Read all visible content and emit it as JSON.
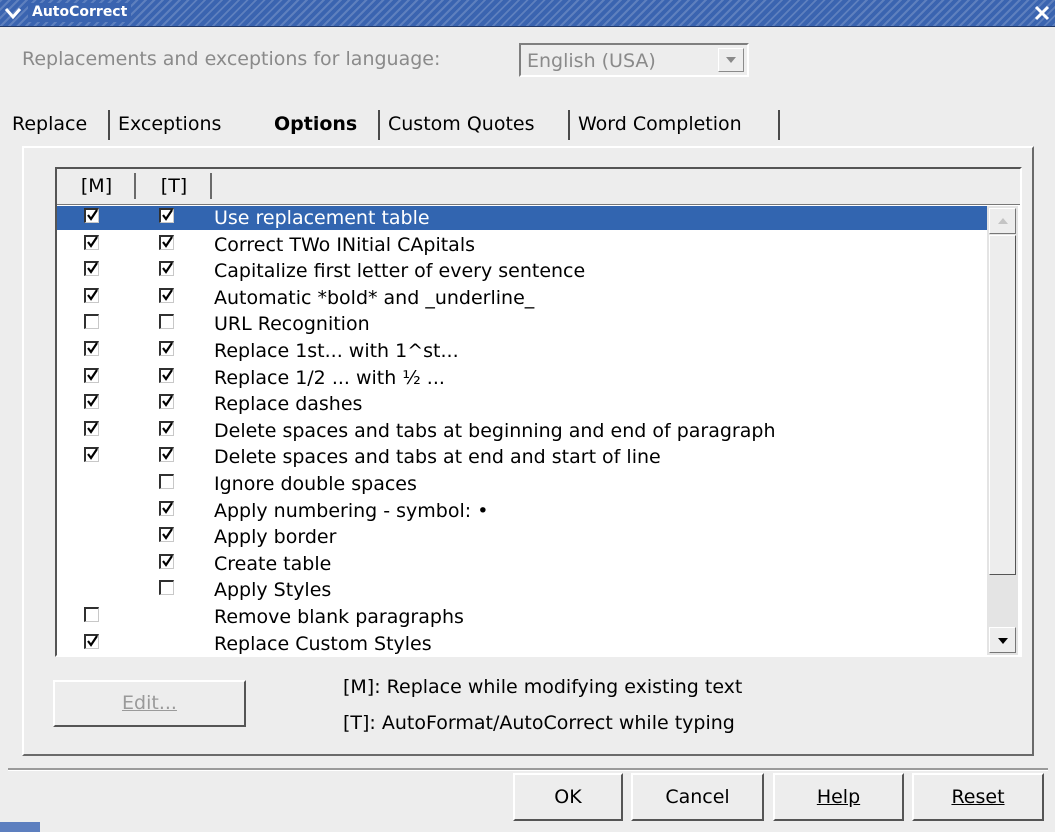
{
  "window": {
    "title": "AutoCorrect"
  },
  "language": {
    "label": "Replacements and exceptions for language:",
    "value": "English (USA)"
  },
  "tabs": [
    {
      "label": "Replace",
      "active": false
    },
    {
      "label": "Exceptions",
      "active": false
    },
    {
      "label": "Options",
      "active": true
    },
    {
      "label": "Custom Quotes",
      "active": false
    },
    {
      "label": "Word Completion",
      "active": false
    }
  ],
  "options": {
    "columns": [
      "[M]",
      "[T]"
    ],
    "rows": [
      {
        "label": "Use replacement table",
        "m": true,
        "t": true,
        "selected": true
      },
      {
        "label": "Correct TWo INitial CApitals",
        "m": true,
        "t": true
      },
      {
        "label": "Capitalize first letter of every sentence",
        "m": true,
        "t": true
      },
      {
        "label": "Automatic *bold* and _underline_",
        "m": true,
        "t": true
      },
      {
        "label": "URL Recognition",
        "m": false,
        "t": false
      },
      {
        "label": "Replace 1st... with 1^st...",
        "m": true,
        "t": true
      },
      {
        "label": "Replace 1/2 ... with ½ ...",
        "m": true,
        "t": true
      },
      {
        "label": "Replace dashes",
        "m": true,
        "t": true
      },
      {
        "label": "Delete spaces and tabs at beginning and end of paragraph",
        "m": true,
        "t": true
      },
      {
        "label": "Delete spaces and tabs at end and start of line",
        "m": true,
        "t": true
      },
      {
        "label": "Ignore double spaces",
        "m": null,
        "t": false
      },
      {
        "label": "Apply numbering - symbol: •",
        "m": null,
        "t": true
      },
      {
        "label": "Apply border",
        "m": null,
        "t": true
      },
      {
        "label": "Create table",
        "m": null,
        "t": true
      },
      {
        "label": "Apply Styles",
        "m": null,
        "t": false
      },
      {
        "label": "Remove blank paragraphs",
        "m": false,
        "t": null
      },
      {
        "label": "Replace Custom Styles",
        "m": true,
        "t": null
      }
    ]
  },
  "edit_button": {
    "label": "Edit..."
  },
  "legend": {
    "m": "[M]: Replace while modifying existing text",
    "t": "[T]: AutoFormat/AutoCorrect while typing"
  },
  "footer": {
    "ok": "OK",
    "cancel": "Cancel",
    "help": "Help",
    "reset": "Reset"
  },
  "colors": {
    "selection": "#3265b0",
    "titlebar": "#3a64b0"
  },
  "icons": {
    "window_menu": "chevron-down-icon",
    "close": "close-icon",
    "check": "check-icon"
  }
}
